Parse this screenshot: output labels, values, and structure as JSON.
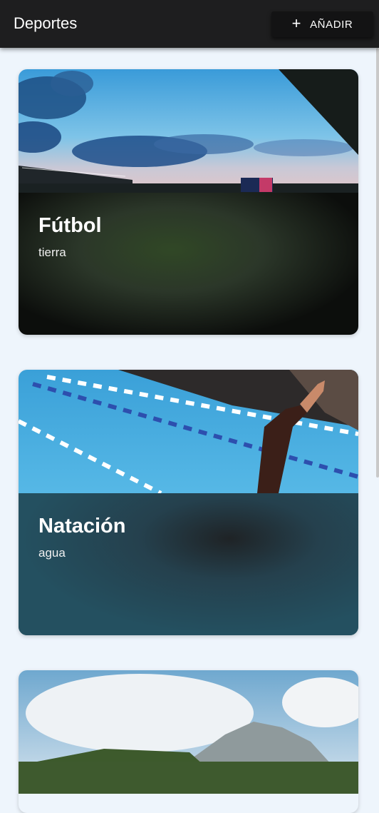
{
  "appbar": {
    "title": "Deportes",
    "add_label": "AÑADIR"
  },
  "cards": [
    {
      "title": "Fútbol",
      "subtitle": "tierra",
      "view_icon_color": "#f5e61a"
    },
    {
      "title": "Natación",
      "subtitle": "agua",
      "view_icon_color": "#ffffff"
    },
    {
      "title": "",
      "subtitle": ""
    }
  ],
  "colors": {
    "delete": "#d9363e",
    "appbar": "#1e1e1f",
    "background": "#eef5fc"
  }
}
